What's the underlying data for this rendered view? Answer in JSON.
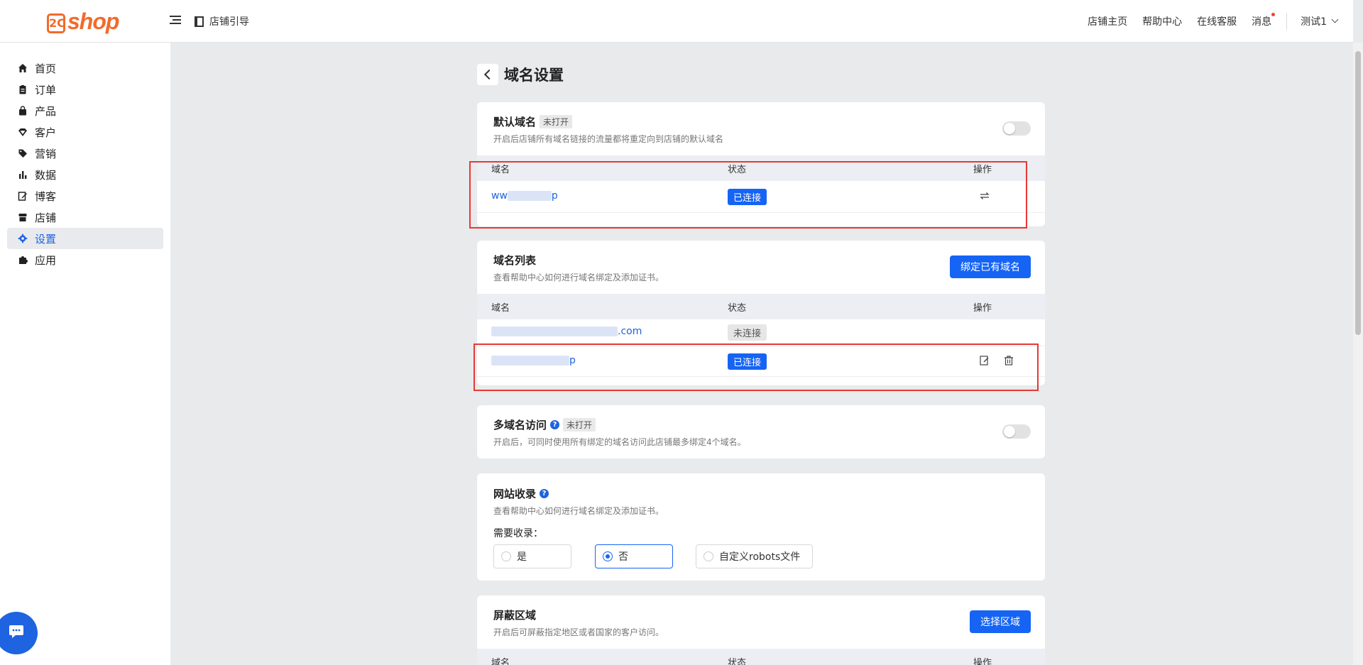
{
  "logo": {
    "box_text": "2C",
    "text": "shop"
  },
  "header": {
    "guide_label": "店铺引导",
    "links": [
      "店铺主页",
      "帮助中心",
      "在线客服",
      "消息"
    ],
    "user": "测试1"
  },
  "sidebar": {
    "items": [
      {
        "label": "首页",
        "icon": "home-icon"
      },
      {
        "label": "订单",
        "icon": "clipboard-icon"
      },
      {
        "label": "产品",
        "icon": "bag-icon"
      },
      {
        "label": "客户",
        "icon": "diamond-icon"
      },
      {
        "label": "营销",
        "icon": "tag-icon"
      },
      {
        "label": "数据",
        "icon": "bar-chart-icon"
      },
      {
        "label": "博客",
        "icon": "edit-icon"
      },
      {
        "label": "店铺",
        "icon": "store-icon"
      },
      {
        "label": "设置",
        "icon": "gear-icon",
        "active": true
      },
      {
        "label": "应用",
        "icon": "puzzle-icon"
      }
    ]
  },
  "page": {
    "title": "域名设置"
  },
  "default_domain": {
    "title": "默认域名",
    "status_tag": "未打开",
    "desc": "开启后店铺所有域名链接的流量都将重定向到店铺的默认域名",
    "toggle_on": false,
    "columns": [
      "域名",
      "状态",
      "操作"
    ],
    "row": {
      "domain_prefix": "ww",
      "domain_suffix": "p",
      "status": "已连接"
    }
  },
  "domain_list": {
    "title": "域名列表",
    "desc": "查看帮助中心如何进行域名绑定及添加证书。",
    "button": "绑定已有域名",
    "columns": [
      "域名",
      "状态",
      "操作"
    ],
    "rows": [
      {
        "domain_prefix": "",
        "domain_suffix": ".com",
        "status": "未连接"
      },
      {
        "domain_prefix": "",
        "domain_suffix": "p",
        "status": "已连接"
      }
    ]
  },
  "multi_domain": {
    "title": "多域名访问",
    "status_tag": "未打开",
    "desc": "开启后，可同时使用所有绑定的域名访问此店铺最多绑定4个域名。",
    "toggle_on": false
  },
  "indexing": {
    "title": "网站收录",
    "desc": "查看帮助中心如何进行域名绑定及添加证书。",
    "label": "需要收录：",
    "options": [
      "是",
      "否",
      "自定义robots文件"
    ],
    "selected": "否"
  },
  "block_region": {
    "title": "屏蔽区域",
    "desc": "开启后可屏蔽指定地区或者国家的客户访问。",
    "button": "选择区域",
    "columns": [
      "域名",
      "状态",
      "操作"
    ]
  },
  "colors": {
    "accent": "#1664f4",
    "brand": "#f26a2b",
    "annotation": "#e53935"
  }
}
